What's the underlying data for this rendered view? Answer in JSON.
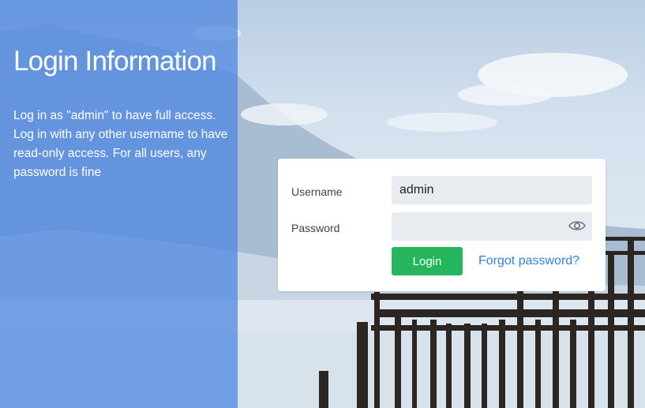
{
  "info": {
    "title": "Login Information",
    "text": "Log in as \"admin\" to have full access. Log in with any other username to have read-only access. For all users, any password is fine"
  },
  "form": {
    "username_label": "Username",
    "username_value": "admin",
    "password_label": "Password",
    "password_value": "",
    "login_label": "Login",
    "forgot_label": "Forgot password?"
  },
  "icons": {
    "password_toggle": "eye-icon"
  },
  "colors": {
    "panel": "#4a84e0",
    "login_button": "#25b55d",
    "link": "#3a7fd5",
    "field_bg": "#e8ebef"
  }
}
